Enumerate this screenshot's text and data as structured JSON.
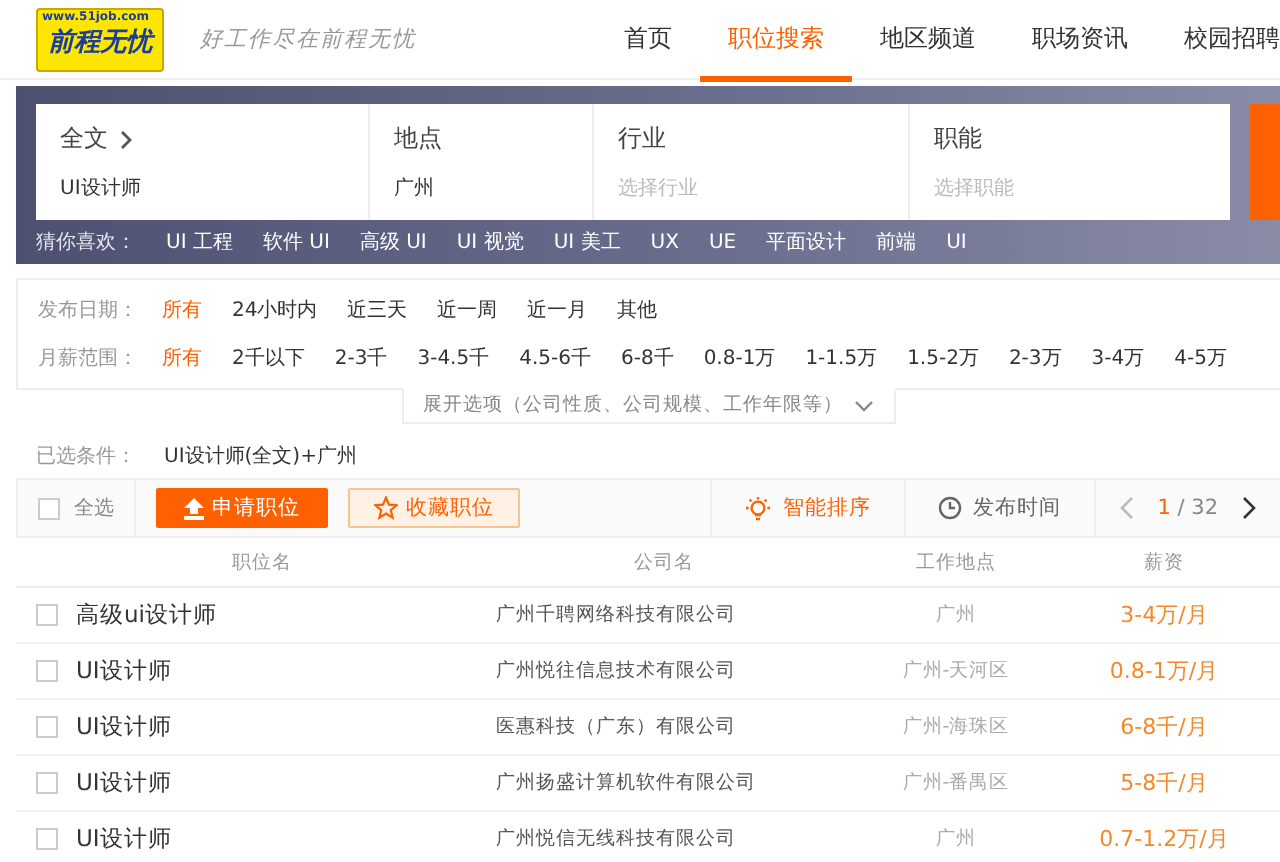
{
  "header": {
    "logo": {
      "url": "www.51job.com",
      "name": "前程无忧"
    },
    "slogan": "好工作尽在前程无忧",
    "nav": [
      {
        "label": "首页",
        "selected": false
      },
      {
        "label": "职位搜索",
        "selected": true
      },
      {
        "label": "地区频道",
        "selected": false
      },
      {
        "label": "职场资讯",
        "selected": false
      },
      {
        "label": "校园招聘",
        "selected": false
      }
    ]
  },
  "search": {
    "fields": [
      {
        "label": "全文",
        "value": "UI设计师",
        "has_arrow": true
      },
      {
        "label": "地点",
        "value": "广州"
      },
      {
        "label": "行业",
        "placeholder": "选择行业"
      },
      {
        "label": "职能",
        "placeholder": "选择职能"
      }
    ]
  },
  "recommend": {
    "label": "猜你喜欢：",
    "tags": [
      "UI 工程",
      "软件 UI",
      "高级 UI",
      "UI 视觉",
      "UI 美工",
      "UX",
      "UE",
      "平面设计",
      "前端",
      "UI"
    ]
  },
  "filters": [
    {
      "label": "发布日期：",
      "options": [
        {
          "label": "所有",
          "selected": true
        },
        {
          "label": "24小时内",
          "selected": false
        },
        {
          "label": "近三天",
          "selected": false
        },
        {
          "label": "近一周",
          "selected": false
        },
        {
          "label": "近一月",
          "selected": false
        },
        {
          "label": "其他",
          "selected": false
        }
      ]
    },
    {
      "label": "月薪范围：",
      "options": [
        {
          "label": "所有",
          "selected": true
        },
        {
          "label": "2千以下",
          "selected": false
        },
        {
          "label": "2-3千",
          "selected": false
        },
        {
          "label": "3-4.5千",
          "selected": false
        },
        {
          "label": "4.5-6千",
          "selected": false
        },
        {
          "label": "6-8千",
          "selected": false
        },
        {
          "label": "0.8-1万",
          "selected": false
        },
        {
          "label": "1-1.5万",
          "selected": false
        },
        {
          "label": "1.5-2万",
          "selected": false
        },
        {
          "label": "2-3万",
          "selected": false
        },
        {
          "label": "3-4万",
          "selected": false
        },
        {
          "label": "4-5万",
          "selected": false
        }
      ]
    }
  ],
  "expand": "展开选项（公司性质、公司规模、工作年限等）",
  "conditions": {
    "label": "已选条件：",
    "value": "UI设计师(全文)+广州"
  },
  "toolbar": {
    "select_all": {
      "label": "全选",
      "checked": false
    },
    "apply": "申请职位",
    "favorite": "收藏职位",
    "sorts": [
      {
        "kind": "smart",
        "label": "智能排序",
        "selected": true
      },
      {
        "kind": "time",
        "label": "发布时间",
        "selected": false
      }
    ],
    "pager": {
      "current": "1",
      "total": "/ 32"
    }
  },
  "table": {
    "columns": [
      "职位名",
      "公司名",
      "工作地点",
      "薪资"
    ],
    "rows": [
      {
        "checked": false,
        "title": "高级ui设计师",
        "company": "广州千聘网络科技有限公司",
        "location": "广州",
        "salary": "3-4万/月"
      },
      {
        "checked": false,
        "title": "UI设计师",
        "company": "广州悦往信息技术有限公司",
        "location": "广州-天河区",
        "salary": "0.8-1万/月"
      },
      {
        "checked": false,
        "title": "UI设计师",
        "company": "医惠科技（广东）有限公司",
        "location": "广州-海珠区",
        "salary": "6-8千/月"
      },
      {
        "checked": false,
        "title": "UI设计师",
        "company": "广州扬盛计算机软件有限公司",
        "location": "广州-番禺区",
        "salary": "5-8千/月"
      },
      {
        "checked": false,
        "title": "UI设计师",
        "company": "广州悦信无线科技有限公司",
        "location": "广州",
        "salary": "0.7-1.2万/月"
      }
    ]
  }
}
